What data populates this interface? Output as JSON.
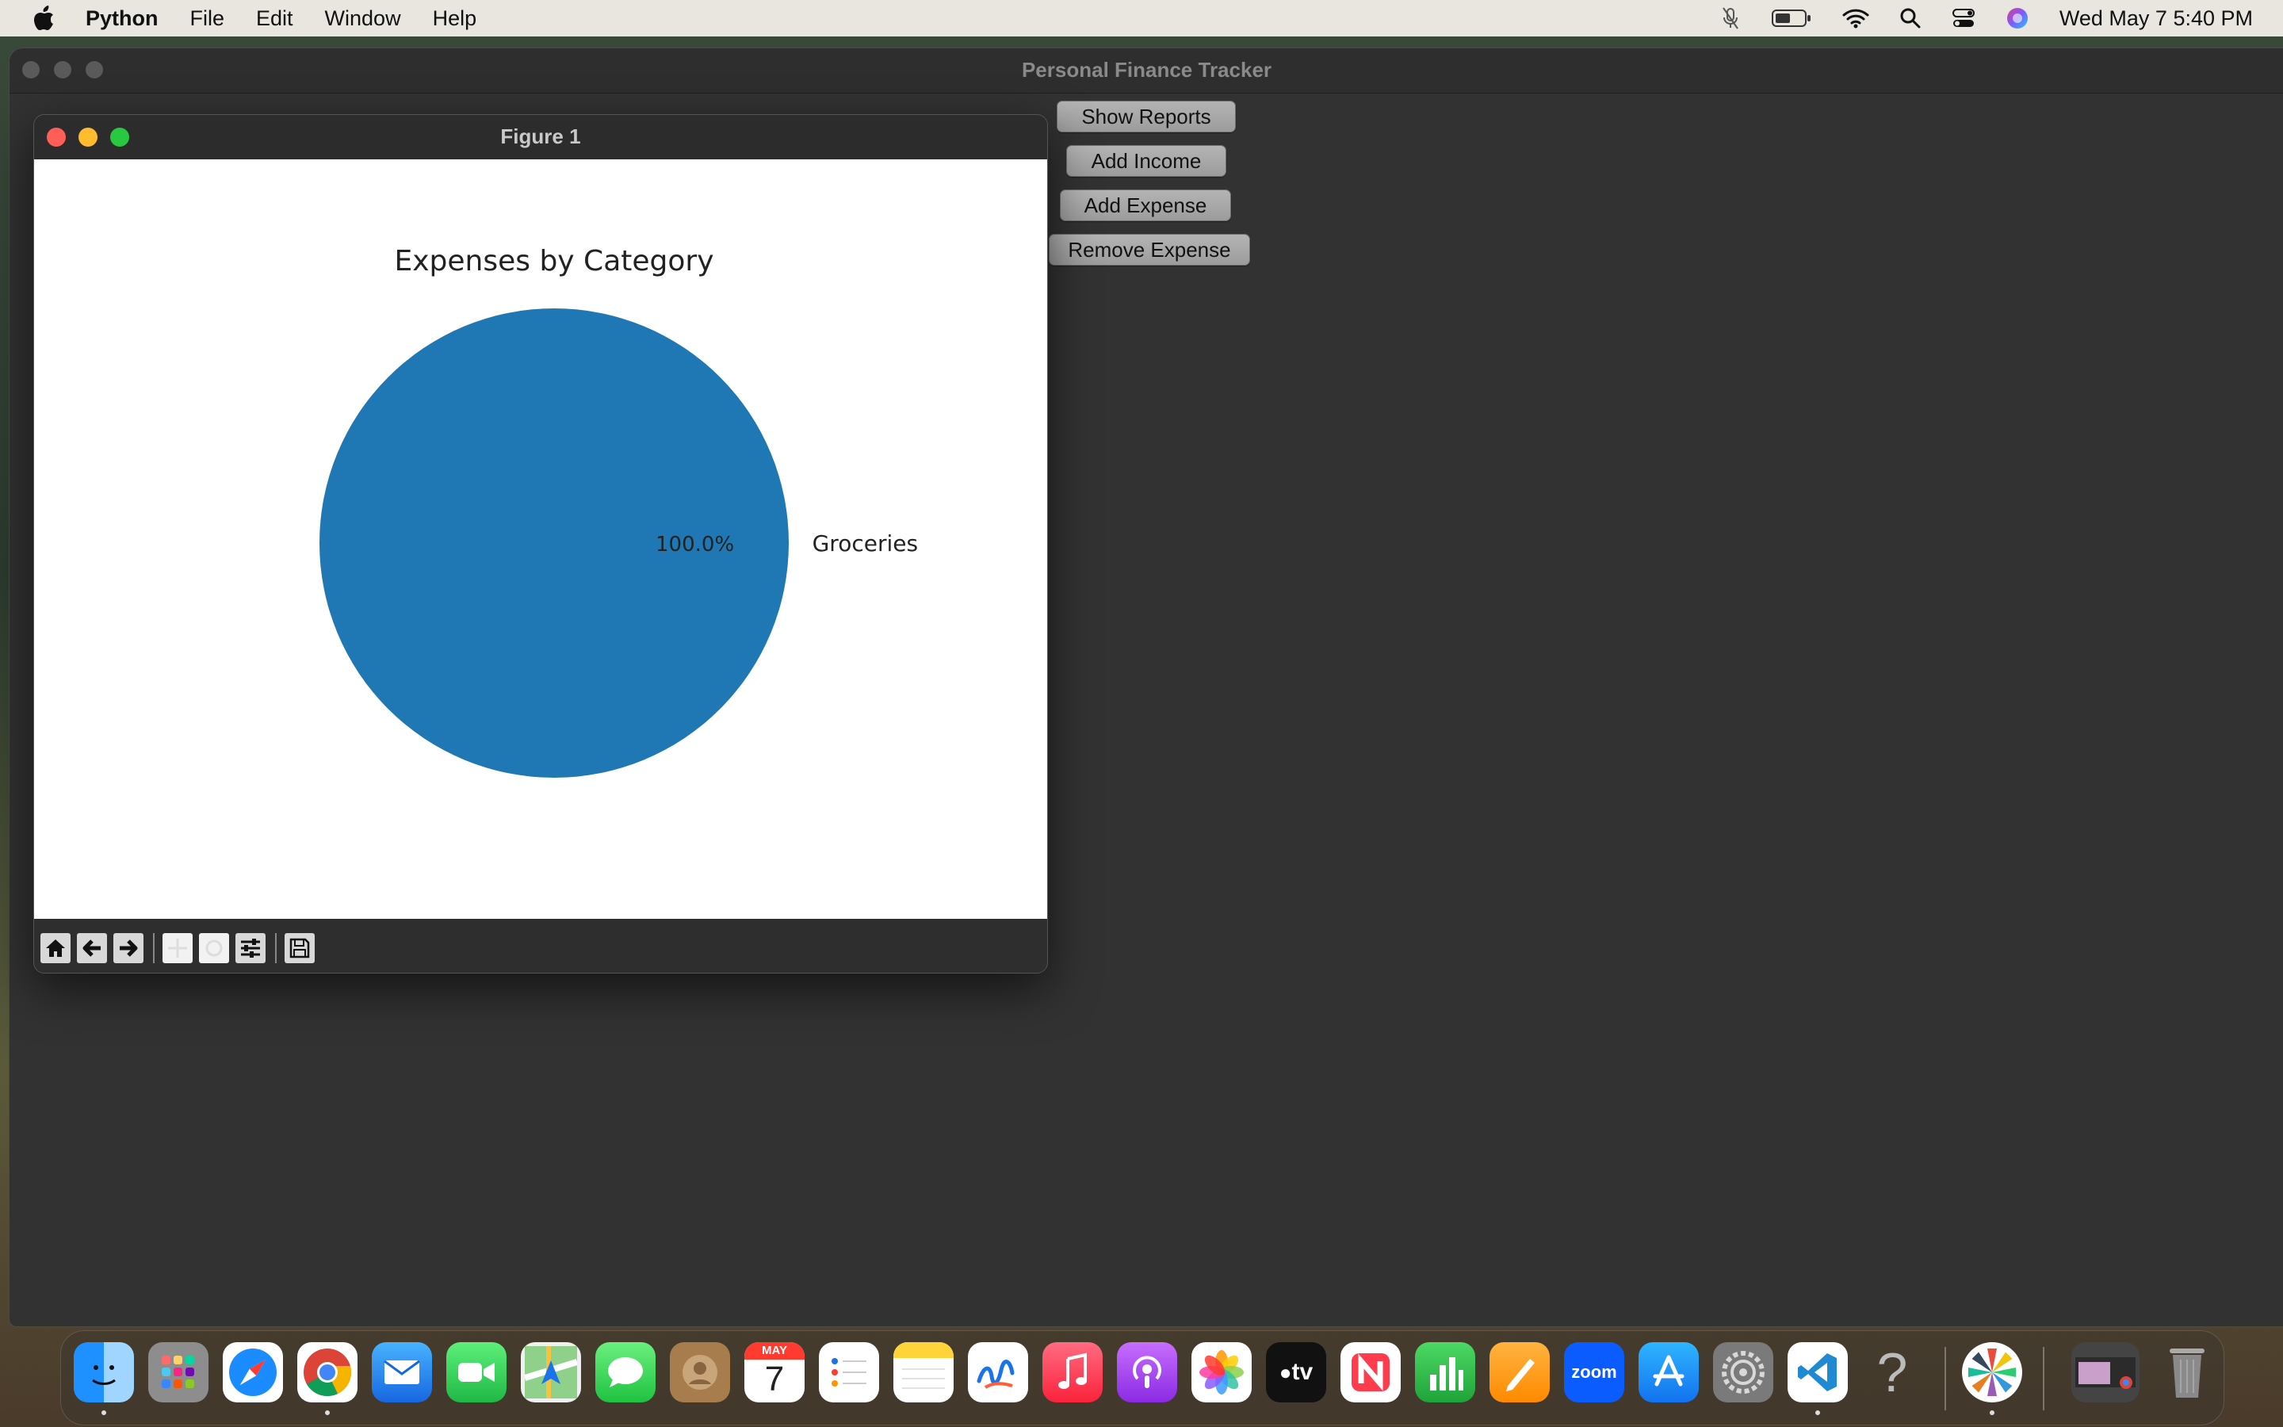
{
  "menubar": {
    "app_name": "Python",
    "items": [
      "File",
      "Edit",
      "Window",
      "Help"
    ],
    "clock": "Wed May 7  5:40 PM"
  },
  "main_window": {
    "title": "Personal Finance Tracker",
    "buttons": {
      "show_reports": "Show Reports",
      "add_income": "Add Income",
      "add_expense": "Add Expense",
      "remove_expense": "Remove Expense"
    }
  },
  "figure_window": {
    "title": "Figure 1"
  },
  "chart_data": {
    "type": "pie",
    "title": "Expenses by Category",
    "categories": [
      "Groceries"
    ],
    "values": [
      100
    ],
    "labels": [
      "100.0%"
    ],
    "colors": [
      "#1f77b4"
    ]
  },
  "dock": {
    "calendar_month": "MAY",
    "calendar_day": "7",
    "zoom_label": "zoom",
    "tv_label": "tv"
  }
}
